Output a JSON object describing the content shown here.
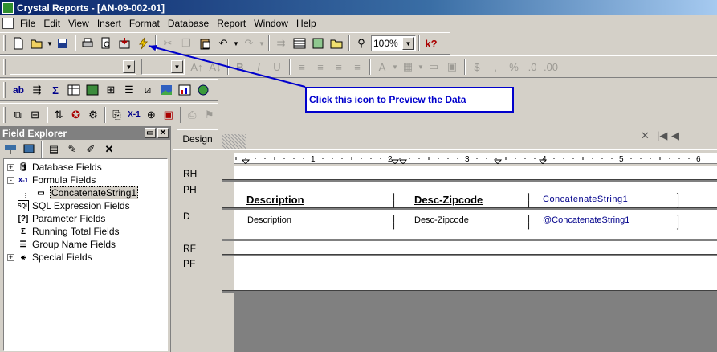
{
  "window": {
    "title": "Crystal Reports - [AN-09-002-01]"
  },
  "menu": [
    "File",
    "Edit",
    "View",
    "Insert",
    "Format",
    "Database",
    "Report",
    "Window",
    "Help"
  ],
  "toolbar": {
    "zoom": "100%"
  },
  "callout": {
    "text": "Click this icon to Preview the Data"
  },
  "field_explorer": {
    "title": "Field Explorer",
    "items": [
      {
        "label": "Database Fields",
        "expander": "+",
        "icon": "database-icon"
      },
      {
        "label": "Formula Fields",
        "expander": "-",
        "icon": "formula-icon"
      },
      {
        "label": "ConcatenateString1",
        "expander": "",
        "icon": "formula-item-icon"
      },
      {
        "label": "SQL Expression Fields",
        "expander": "",
        "icon": "sql-icon"
      },
      {
        "label": "Parameter Fields",
        "expander": "",
        "icon": "parameter-icon"
      },
      {
        "label": "Running Total Fields",
        "expander": "",
        "icon": "sigma-icon"
      },
      {
        "label": "Group Name Fields",
        "expander": "",
        "icon": "group-icon"
      },
      {
        "label": "Special Fields",
        "expander": "+",
        "icon": "special-icon"
      }
    ]
  },
  "design": {
    "tab": "Design",
    "ruler_marks": [
      "1",
      "2",
      "3",
      "4",
      "5",
      "6"
    ],
    "sections": [
      "RH",
      "PH",
      "D",
      "RF",
      "PF"
    ],
    "page_header": [
      "Description",
      "Desc-Zipcode",
      "ConcatenateString1"
    ],
    "details": [
      "Description",
      "Desc-Zipcode",
      "@ConcatenateString1"
    ]
  }
}
